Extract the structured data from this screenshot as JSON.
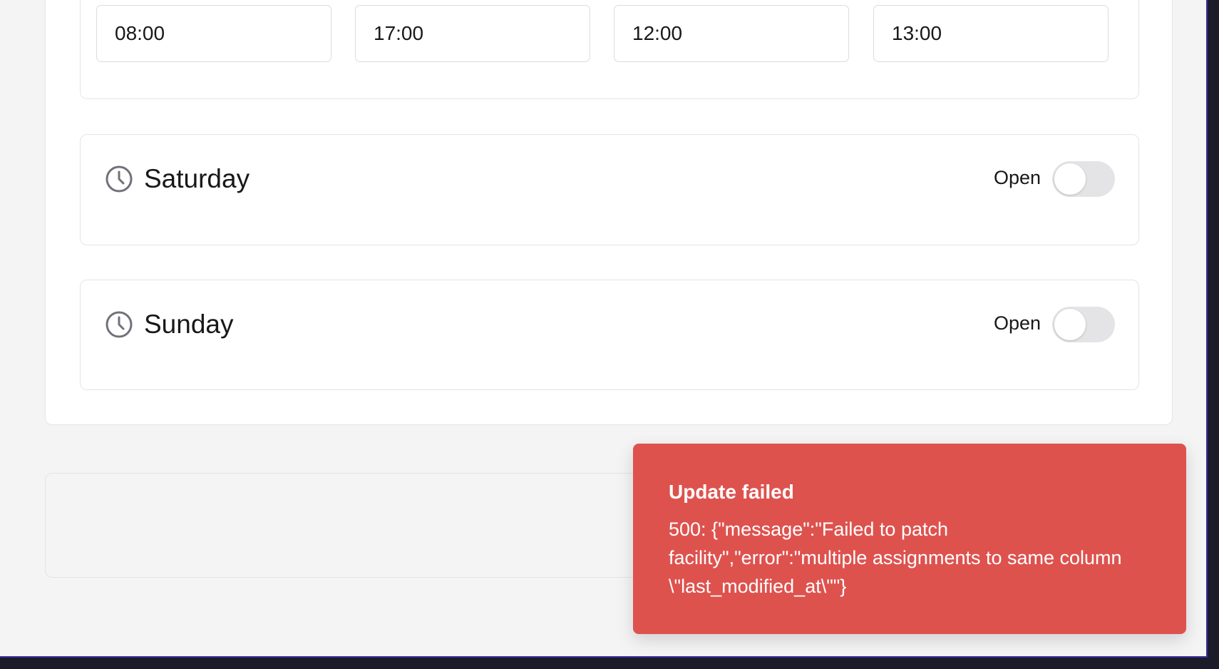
{
  "friday": {
    "times": [
      "08:00",
      "17:00",
      "12:00",
      "13:00"
    ]
  },
  "days": [
    {
      "name": "Saturday",
      "open_label": "Open",
      "open": false
    },
    {
      "name": "Sunday",
      "open_label": "Open",
      "open": false
    }
  ],
  "icons": {
    "day": "clock-icon"
  },
  "toast": {
    "title": "Update failed",
    "message": "500: {\"message\":\"Failed to patch facility\",\"error\":\"multiple assignments to same column \\\"last_modified_at\\\"\"}",
    "background": "#de524e"
  },
  "colors": {
    "page_background": "#f4f4f5",
    "card_border": "#e4e4e7",
    "toggle_off": "#e4e4e7",
    "frame": "#3a2f9a"
  }
}
